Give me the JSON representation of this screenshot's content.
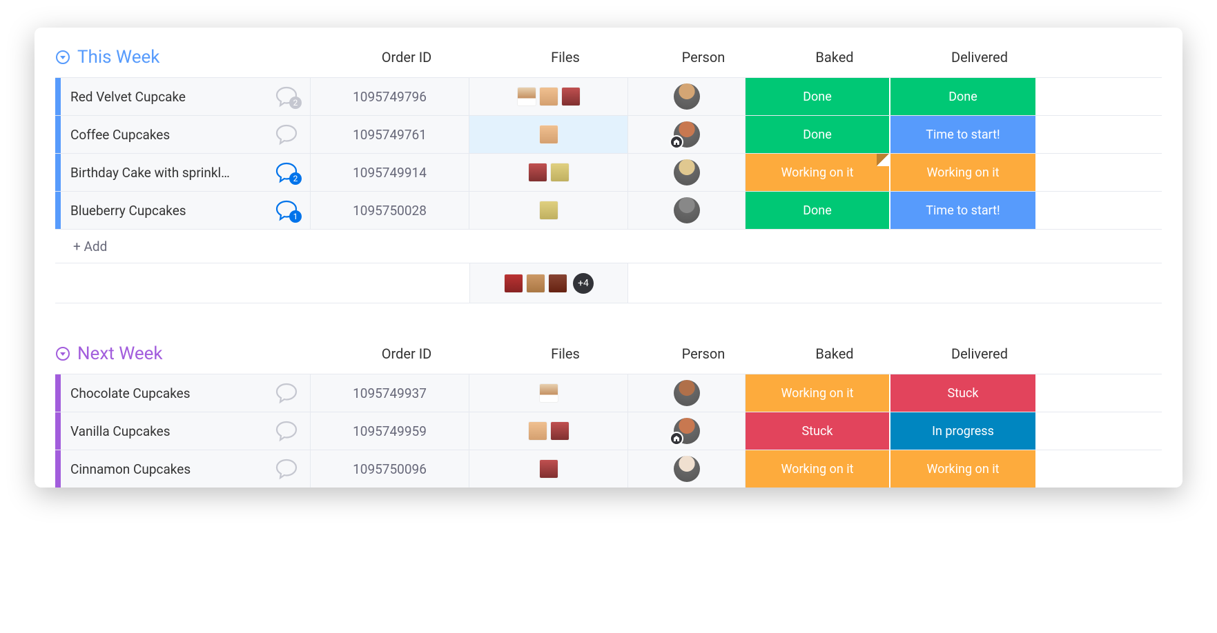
{
  "columns": {
    "orderid": "Order ID",
    "files": "Files",
    "person": "Person",
    "baked": "Baked",
    "delivered": "Delivered"
  },
  "status_colors": {
    "done": "#00c875",
    "working": "#fdab3d",
    "time_to_start": "#579bfc",
    "stuck": "#e2445c",
    "in_progress": "#0086c0"
  },
  "groups": [
    {
      "title": "This Week",
      "color": "#579bfc",
      "bar_color": "#579bfc",
      "add_label": "+ Add",
      "summary": {
        "thumbs": 3,
        "more": "+4"
      },
      "rows": [
        {
          "name": "Red Velvet Cupcake",
          "order_id": "1095749796",
          "chat": {
            "active": false,
            "badge": "2",
            "badge_color": "#c5c7d0"
          },
          "files_count": 3,
          "files_highlight": false,
          "avatar_color": "#d4a574",
          "avatar_badge": false,
          "baked": {
            "label": "Done",
            "color_key": "done",
            "fold": false
          },
          "delivered": {
            "label": "Done",
            "color_key": "done",
            "fold": false
          }
        },
        {
          "name": "Coffee Cupcakes",
          "order_id": "1095749761",
          "chat": {
            "active": false,
            "badge": "",
            "badge_color": ""
          },
          "files_count": 1,
          "files_highlight": true,
          "avatar_color": "#c87850",
          "avatar_badge": true,
          "baked": {
            "label": "Done",
            "color_key": "done",
            "fold": false
          },
          "delivered": {
            "label": "Time to start!",
            "color_key": "time_to_start",
            "fold": false
          }
        },
        {
          "name": "Birthday Cake with sprinkl…",
          "order_id": "1095749914",
          "chat": {
            "active": true,
            "badge": "2",
            "badge_color": "#0073ea"
          },
          "files_count": 2,
          "files_highlight": false,
          "avatar_color": "#e0c890",
          "avatar_badge": false,
          "baked": {
            "label": "Working on it",
            "color_key": "working",
            "fold": true
          },
          "delivered": {
            "label": "Working on it",
            "color_key": "working",
            "fold": false
          }
        },
        {
          "name": "Blueberry Cupcakes",
          "order_id": "1095750028",
          "chat": {
            "active": true,
            "badge": "1",
            "badge_color": "#0073ea"
          },
          "files_count": 1,
          "files_highlight": false,
          "avatar_color": "#888",
          "avatar_badge": false,
          "baked": {
            "label": "Done",
            "color_key": "done",
            "fold": false
          },
          "delivered": {
            "label": "Time to start!",
            "color_key": "time_to_start",
            "fold": false
          }
        }
      ]
    },
    {
      "title": "Next Week",
      "color": "#a25ddc",
      "bar_color": "#a25ddc",
      "add_label": "",
      "summary": null,
      "rows": [
        {
          "name": "Chocolate Cupcakes",
          "order_id": "1095749937",
          "chat": {
            "active": false,
            "badge": "",
            "badge_color": ""
          },
          "files_count": 1,
          "files_highlight": false,
          "avatar_color": "#b0704a",
          "avatar_badge": false,
          "baked": {
            "label": "Working on it",
            "color_key": "working",
            "fold": false
          },
          "delivered": {
            "label": "Stuck",
            "color_key": "stuck",
            "fold": false
          }
        },
        {
          "name": "Vanilla Cupcakes",
          "order_id": "1095749959",
          "chat": {
            "active": false,
            "badge": "",
            "badge_color": ""
          },
          "files_count": 2,
          "files_highlight": false,
          "avatar_color": "#c87850",
          "avatar_badge": true,
          "baked": {
            "label": "Stuck",
            "color_key": "stuck",
            "fold": false
          },
          "delivered": {
            "label": "In progress",
            "color_key": "in_progress",
            "fold": false
          }
        },
        {
          "name": "Cinnamon Cupcakes",
          "order_id": "1095750096",
          "chat": {
            "active": false,
            "badge": "",
            "badge_color": ""
          },
          "files_count": 1,
          "files_highlight": false,
          "avatar_color": "#f0e0d0",
          "avatar_badge": false,
          "baked": {
            "label": "Working on it",
            "color_key": "working",
            "fold": false
          },
          "delivered": {
            "label": "Working on it",
            "color_key": "working",
            "fold": false
          }
        }
      ]
    }
  ]
}
